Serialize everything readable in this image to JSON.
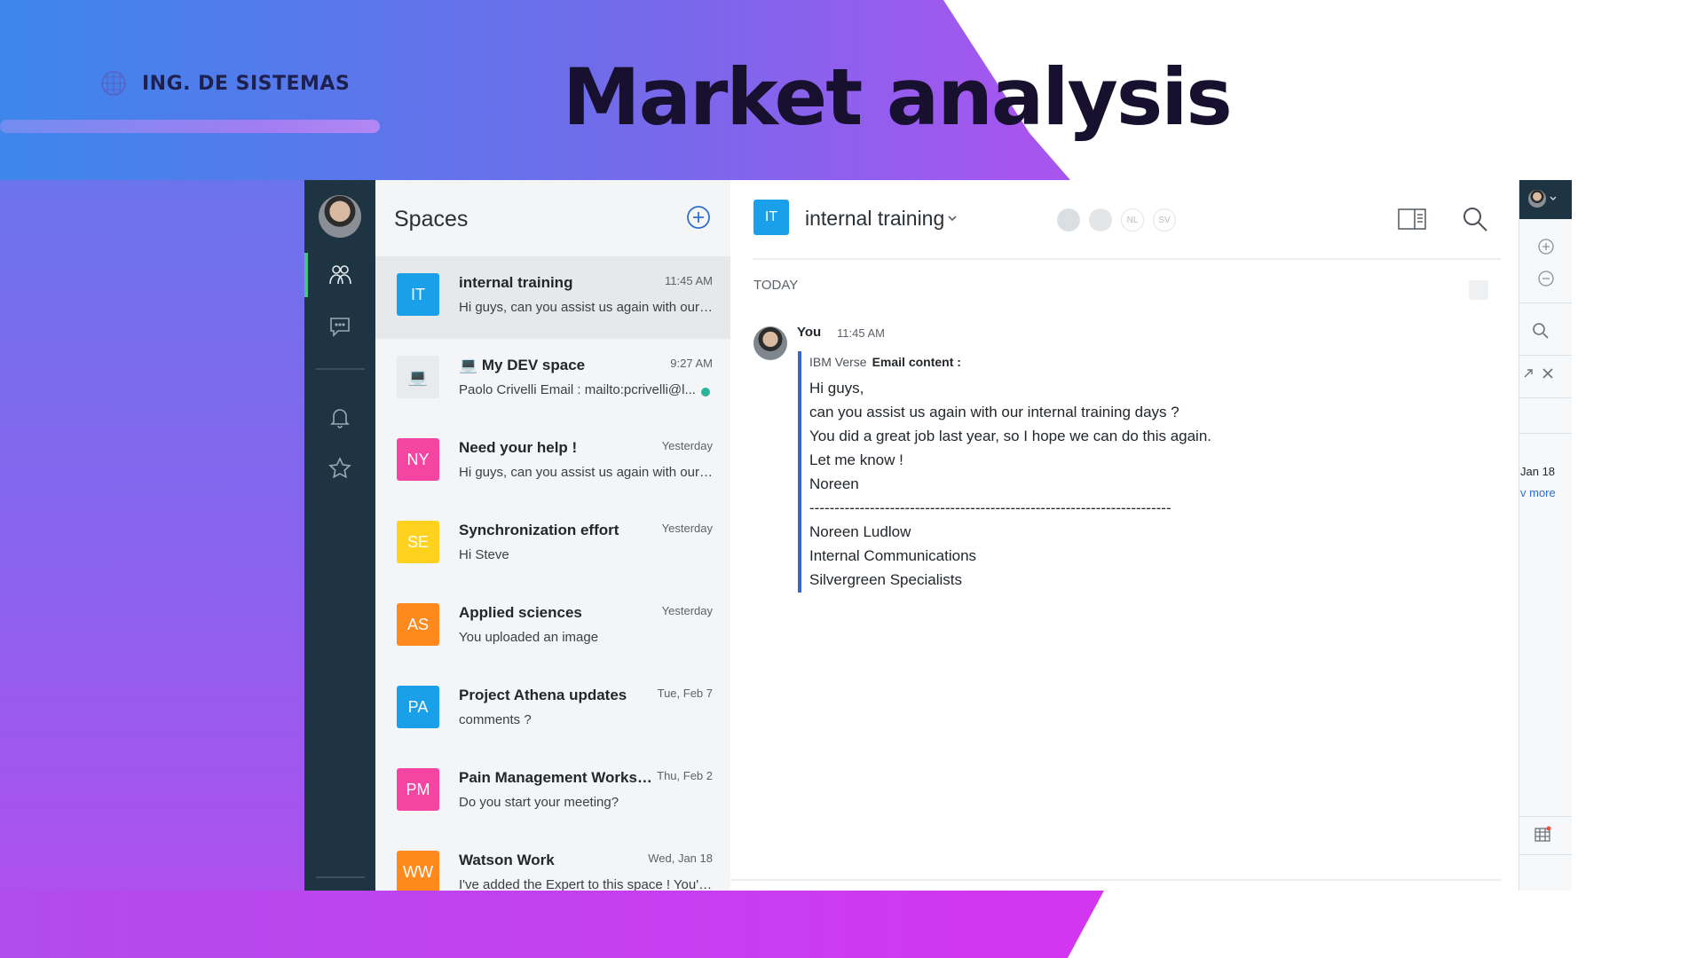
{
  "slide": {
    "brand": "ING. DE SISTEMAS",
    "title": "Market analysis"
  },
  "spaces": {
    "title": "Spaces",
    "items": [
      {
        "initials": "IT",
        "color": "#1aa0e8",
        "name": "internal training",
        "time": "11:45 AM",
        "preview": "Hi guys, can you assist us again with our internal training days ?",
        "active": true,
        "unread": false
      },
      {
        "initials": "💻",
        "color": "#e9eaeb",
        "name": "💻 My DEV space",
        "time": "9:27 AM",
        "preview": "Paolo Crivelli Email : mailto:pcrivelli@l...",
        "active": false,
        "unread": true
      },
      {
        "initials": "NY",
        "color": "#f545a3",
        "name": "Need your help !",
        "time": "Yesterday",
        "preview": "Hi guys, can you assist us again with our internal training days ?",
        "active": false,
        "unread": false
      },
      {
        "initials": "SE",
        "color": "#ffd21f",
        "name": "Synchronization effort",
        "time": "Yesterday",
        "preview": "Hi Steve",
        "active": false,
        "unread": false
      },
      {
        "initials": "AS",
        "color": "#fe8a1e",
        "name": "Applied sciences",
        "time": "Yesterday",
        "preview": "You uploaded an image",
        "active": false,
        "unread": false
      },
      {
        "initials": "PA",
        "color": "#1aa0e8",
        "name": "Project Athena updates",
        "time": "Tue, Feb 7",
        "preview": "comments ?",
        "active": false,
        "unread": false
      },
      {
        "initials": "PM",
        "color": "#f545a3",
        "name": "Pain Management Workshop",
        "time": "Thu, Feb 2",
        "preview": "Do you start your meeting?",
        "active": false,
        "unread": false
      },
      {
        "initials": "WW",
        "color": "#fe8a1e",
        "name": "Watson Work",
        "time": "Wed, Jan 18",
        "preview": "I've added the Expert to this space ! You'll find it useful",
        "active": false,
        "unread": false
      }
    ]
  },
  "chat": {
    "avatar": "IT",
    "title": "internal training",
    "members": [
      "",
      "",
      "NL",
      "SV"
    ],
    "day": "TODAY",
    "message": {
      "author": "You",
      "time": "11:45 AM",
      "source": "IBM Verse",
      "source_label": "Email content :",
      "lines": [
        "Hi guys,",
        "can you assist us again with our internal training days ?",
        "You did a great job last year, so I hope we can do this again.",
        "Let me know !",
        "Noreen",
        "------------------------------------------------------------------------",
        "Noreen Ludlow",
        "Internal Communications",
        "Silvergreen Specialists"
      ]
    }
  },
  "side_panel": {
    "date": "Jan 18",
    "more": "v more"
  },
  "colors": {
    "rail": "#1f3443",
    "accent_green": "#4bbf8a",
    "quote_bar": "#3566c8"
  }
}
